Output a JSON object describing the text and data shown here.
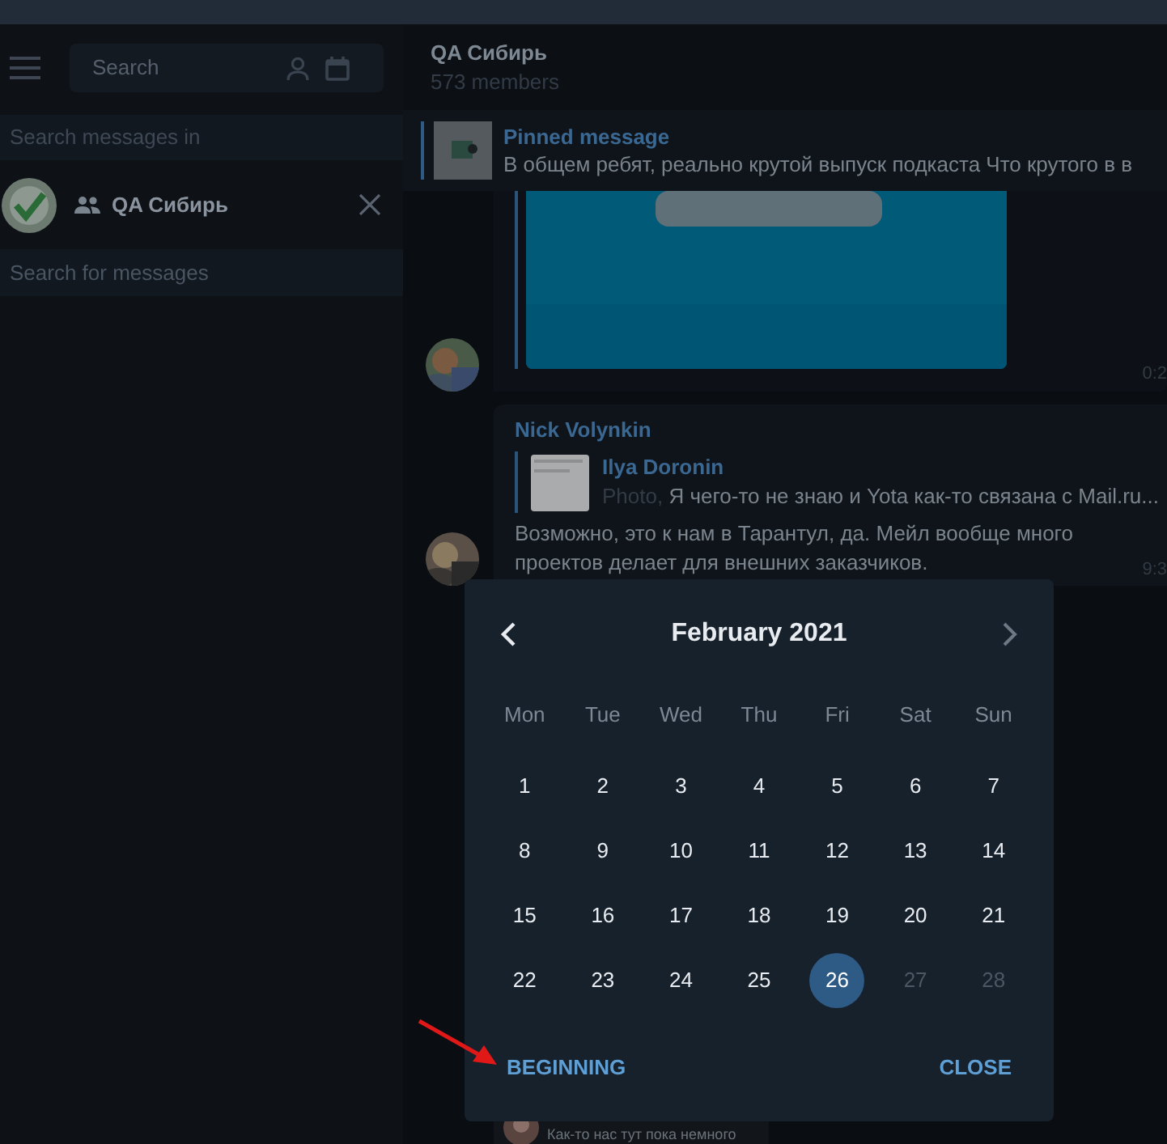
{
  "sidebar": {
    "search": {
      "placeholder": "Search"
    },
    "search_in_label": "Search messages in",
    "chat": {
      "name": "QA Сибирь"
    },
    "message_search": {
      "placeholder": "Search for messages"
    }
  },
  "chat_header": {
    "title": "QA Сибирь",
    "subtitle": "573 members"
  },
  "pinned": {
    "label": "Pinned message",
    "text": "В общем ребят, реально крутой выпуск подкаста Что крутого в в"
  },
  "messages": [
    {
      "time": "0:2"
    },
    {
      "kind": "reply",
      "author": "Nick Volynkin",
      "reply_author": "Ilya Doronin",
      "reply_prefix": "Photo, ",
      "reply_text": "Я чего-то не знаю и Yota как-то связана с Mail.ru...",
      "text": "Возможно, это к нам в Тарантул, да. Мейл вообще много проектов делает для внешних заказчиков.",
      "time": "9:3"
    },
    {
      "kind": "partial",
      "text": "Как-то нас тут пока немного"
    }
  ],
  "calendar": {
    "title": "February 2021",
    "weekdays": [
      "Mon",
      "Tue",
      "Wed",
      "Thu",
      "Fri",
      "Sat",
      "Sun"
    ],
    "weeks": [
      [
        {
          "day": "1",
          "selected": false,
          "disabled": false
        },
        {
          "day": "2",
          "selected": false,
          "disabled": false
        },
        {
          "day": "3",
          "selected": false,
          "disabled": false
        },
        {
          "day": "4",
          "selected": false,
          "disabled": false
        },
        {
          "day": "5",
          "selected": false,
          "disabled": false
        },
        {
          "day": "6",
          "selected": false,
          "disabled": false
        },
        {
          "day": "7",
          "selected": false,
          "disabled": false
        }
      ],
      [
        {
          "day": "8",
          "selected": false,
          "disabled": false
        },
        {
          "day": "9",
          "selected": false,
          "disabled": false
        },
        {
          "day": "10",
          "selected": false,
          "disabled": false
        },
        {
          "day": "11",
          "selected": false,
          "disabled": false
        },
        {
          "day": "12",
          "selected": false,
          "disabled": false
        },
        {
          "day": "13",
          "selected": false,
          "disabled": false
        },
        {
          "day": "14",
          "selected": false,
          "disabled": false
        }
      ],
      [
        {
          "day": "15",
          "selected": false,
          "disabled": false
        },
        {
          "day": "16",
          "selected": false,
          "disabled": false
        },
        {
          "day": "17",
          "selected": false,
          "disabled": false
        },
        {
          "day": "18",
          "selected": false,
          "disabled": false
        },
        {
          "day": "19",
          "selected": false,
          "disabled": false
        },
        {
          "day": "20",
          "selected": false,
          "disabled": false
        },
        {
          "day": "21",
          "selected": false,
          "disabled": false
        }
      ],
      [
        {
          "day": "22",
          "selected": false,
          "disabled": false
        },
        {
          "day": "23",
          "selected": false,
          "disabled": false
        },
        {
          "day": "24",
          "selected": false,
          "disabled": false
        },
        {
          "day": "25",
          "selected": false,
          "disabled": false
        },
        {
          "day": "26",
          "selected": true,
          "disabled": false
        },
        {
          "day": "27",
          "selected": false,
          "disabled": true
        },
        {
          "day": "28",
          "selected": false,
          "disabled": true
        }
      ]
    ],
    "buttons": [
      "BEGINNING",
      "CLOSE"
    ]
  }
}
